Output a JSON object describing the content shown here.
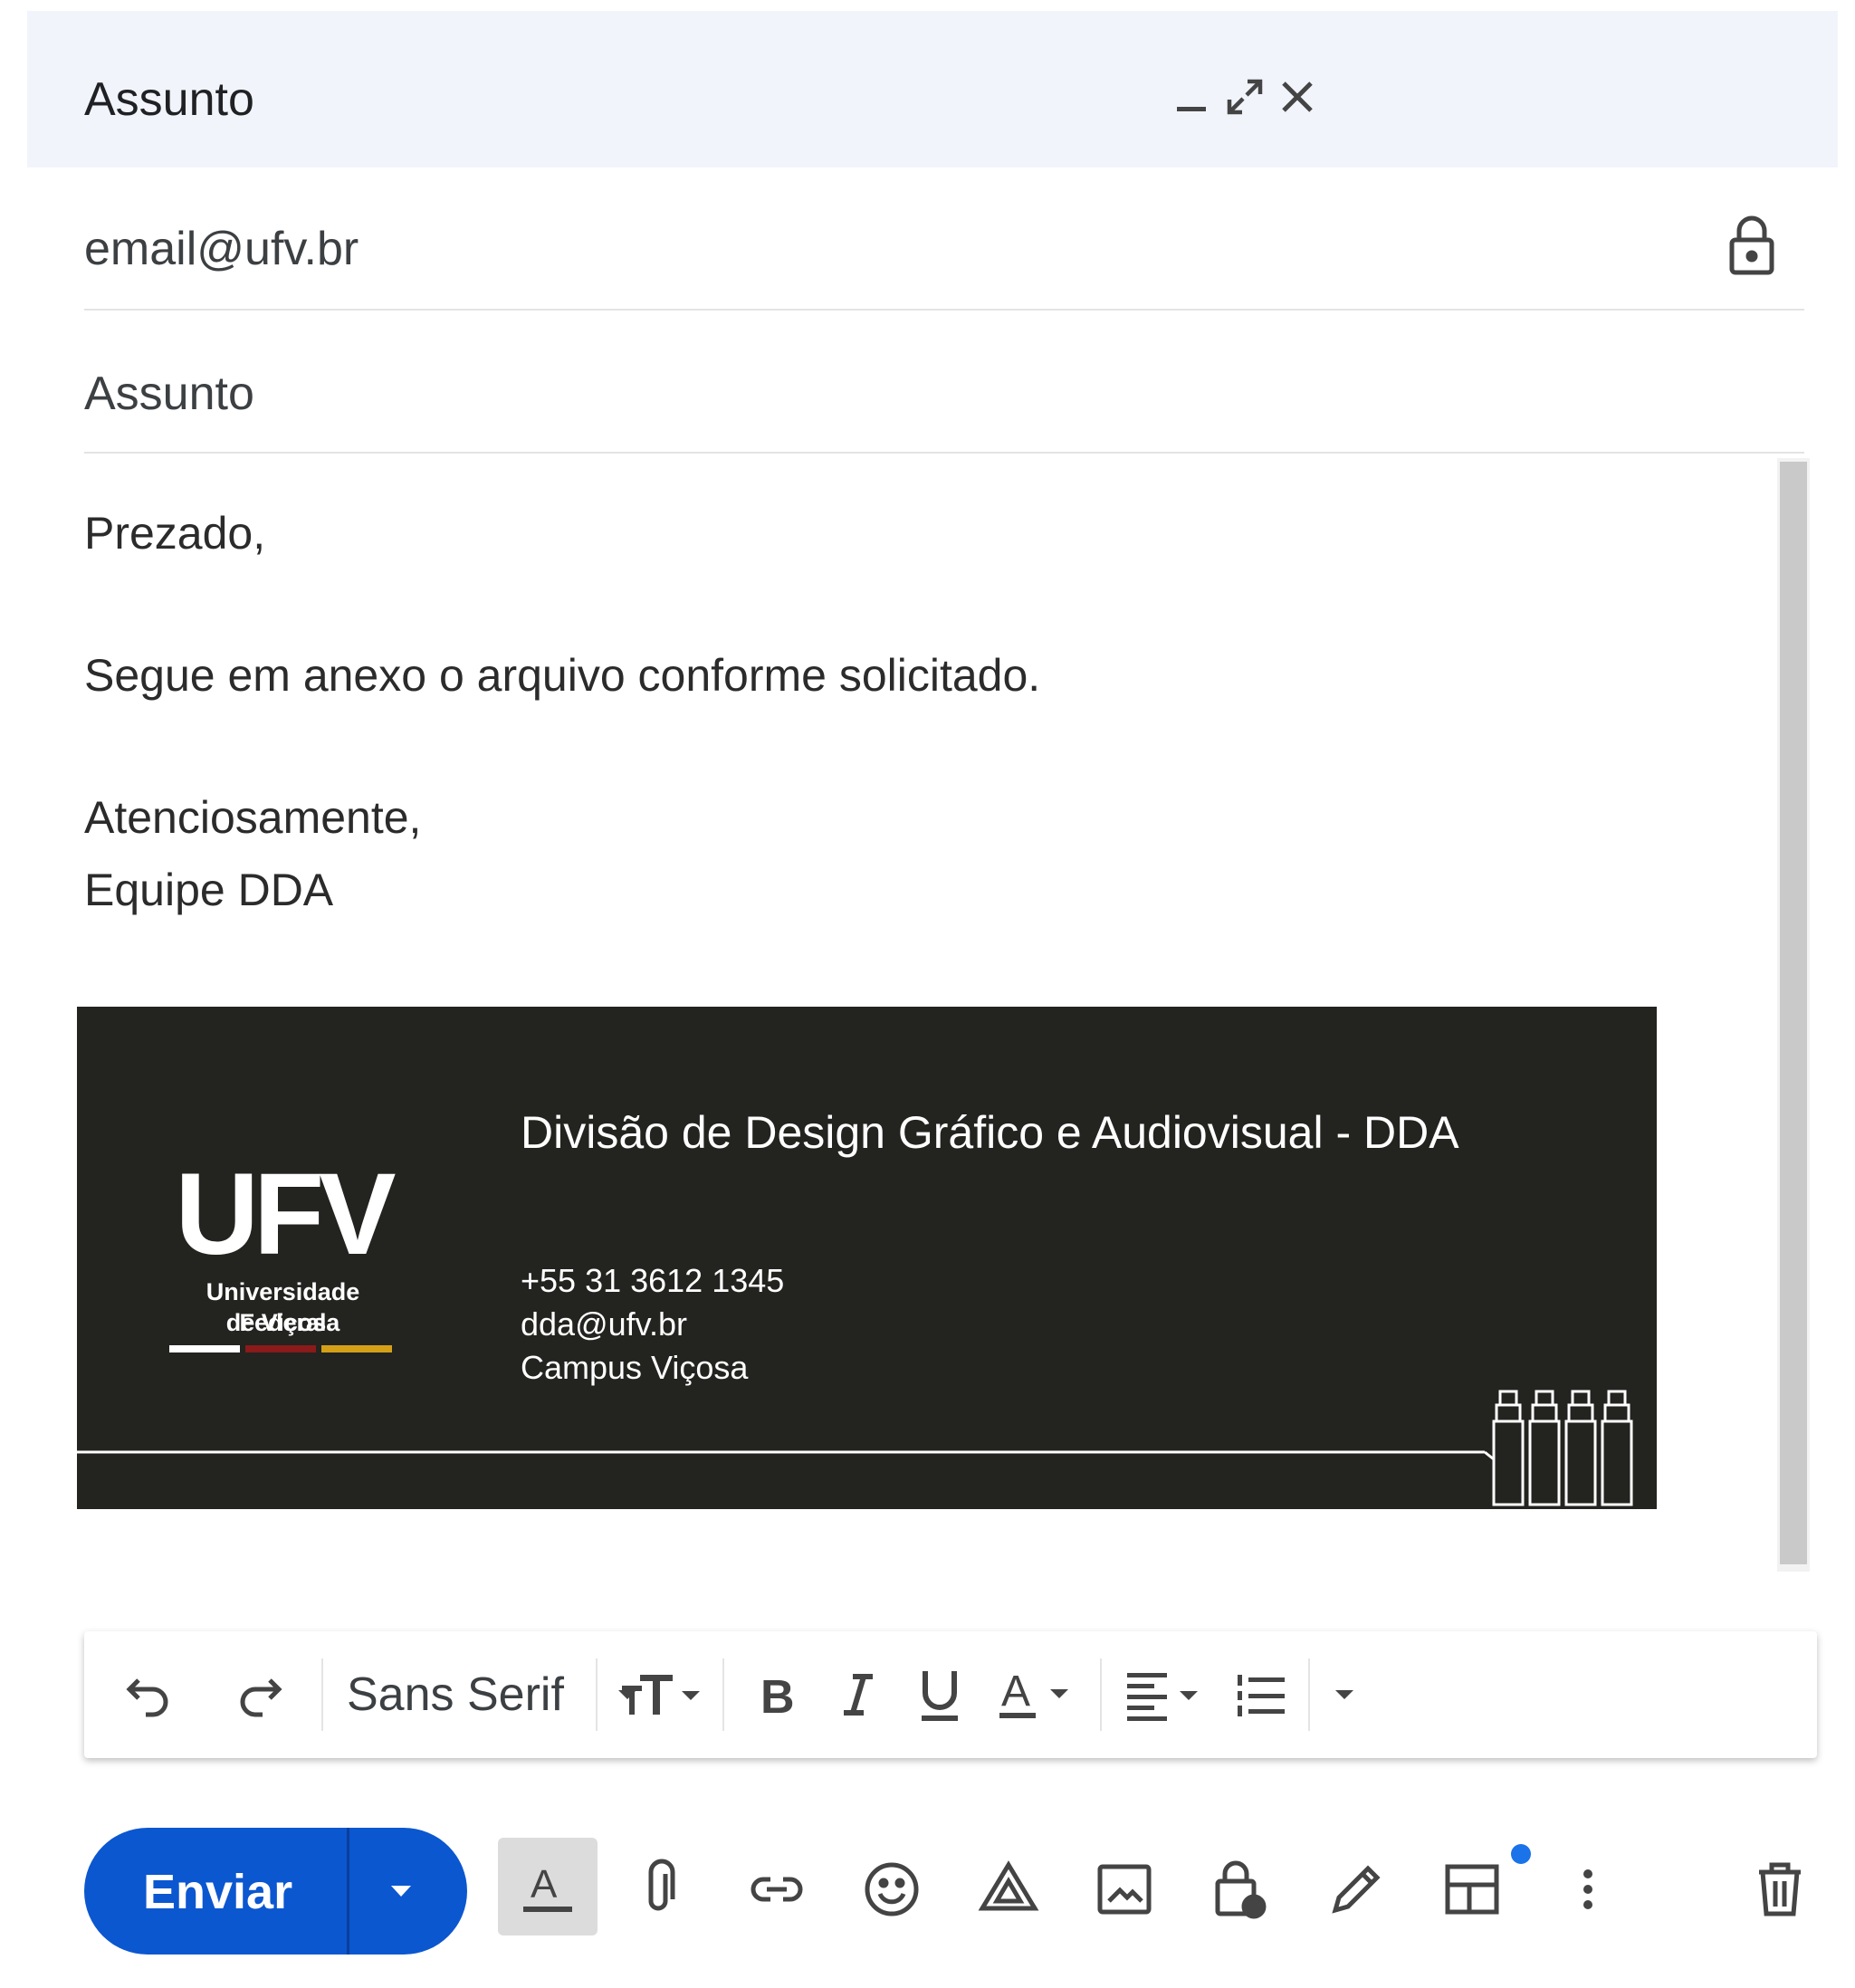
{
  "window": {
    "title": "Assunto",
    "controls": [
      "minimize-icon",
      "fullscreen-icon",
      "close-icon"
    ]
  },
  "to_field": {
    "value": "email@ufv.br",
    "lock_icon": "lock-icon"
  },
  "subject_field": {
    "value": "Assunto"
  },
  "message": {
    "greeting": "Prezado,",
    "line1": "Segue em anexo o arquivo conforme solicitado.",
    "closing": "Atenciosamente,",
    "team": "Equipe DDA"
  },
  "signature": {
    "logo_text": "UFV",
    "logo_sub1": "Universidade Federal",
    "logo_sub2": "de Viçosa",
    "title": "Divisão de Design Gráfico e Audiovisual - DDA",
    "phone": "+55 31 3612 1345",
    "email": "dda@ufv.br",
    "location": "Campus Viçosa",
    "colors": {
      "background": "#232320",
      "stripe1": "#ffffff",
      "stripe2": "#8b1a1a",
      "stripe3": "#d4a017"
    }
  },
  "format_toolbar": {
    "font": "Sans Serif",
    "items": [
      "undo-icon",
      "redo-icon",
      "font-select",
      "text-size-icon",
      "bold-icon",
      "italic-icon",
      "underline-icon",
      "text-color-icon",
      "align-icon",
      "numbered-list-icon",
      "more-formatting-icon"
    ]
  },
  "bottom_bar": {
    "send_label": "Enviar",
    "icons": [
      "text-format-icon",
      "attach-icon",
      "link-icon",
      "emoji-icon",
      "drive-icon",
      "photo-icon",
      "confidential-icon",
      "signature-icon",
      "layout-icon",
      "more-options-icon",
      "trash-icon"
    ],
    "accent": "#0b57d0"
  }
}
